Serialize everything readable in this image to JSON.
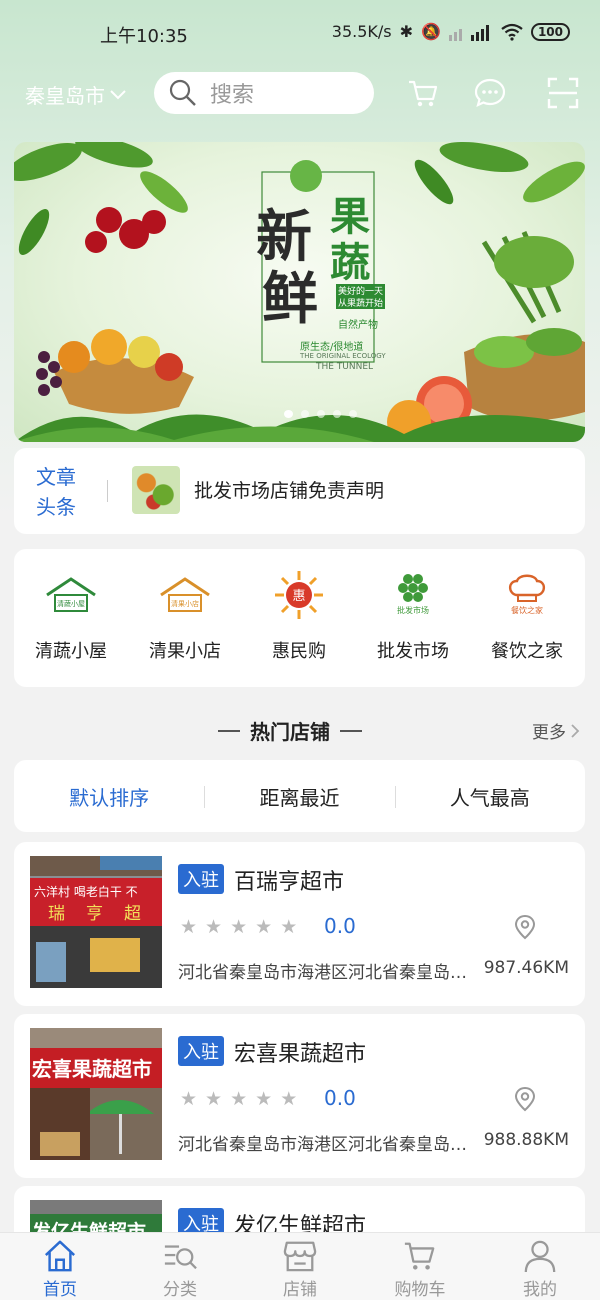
{
  "status_bar": {
    "time": "上午10:35",
    "network_speed": "35.5K/s",
    "battery": "100"
  },
  "header": {
    "city": "秦皇岛市",
    "search_placeholder": "搜索"
  },
  "banner": {
    "title_chars": [
      "新",
      "鲜",
      "果",
      "蔬"
    ],
    "slogan_lines": [
      "美好的一天",
      "从果蔬开始"
    ],
    "tagline": "自然产物",
    "sub": "原生态/很地道",
    "en1": "THE ORIGINAL ECOLOGY",
    "en2": "THE TUNNEL",
    "active_slide": 0,
    "slide_count": 5
  },
  "notice": {
    "tag_line1": "文章",
    "tag_line2": "头条",
    "text": "批发市场店铺免责声明"
  },
  "categories": [
    {
      "label": "清蔬小屋",
      "icon": "green-house-icon",
      "icon_text": "清蔬小屋",
      "color": "#2f8a3b"
    },
    {
      "label": "清果小店",
      "icon": "orange-house-icon",
      "icon_text": "清果小店",
      "color": "#d9902a"
    },
    {
      "label": "惠民购",
      "icon": "discount-burst-icon",
      "icon_text": "惠",
      "color": "#d83a2a"
    },
    {
      "label": "批发市场",
      "icon": "wholesale-grapes-icon",
      "icon_text": "批发市场",
      "color": "#3f9a3a"
    },
    {
      "label": "餐饮之家",
      "icon": "chef-hat-icon",
      "icon_text": "餐饮之家",
      "color": "#d9642a"
    }
  ],
  "hot_shops": {
    "title": "热门店铺",
    "more": "更多"
  },
  "sort_options": [
    {
      "label": "默认排序",
      "active": true
    },
    {
      "label": "距离最近",
      "active": false
    },
    {
      "label": "人气最高",
      "active": false
    }
  ],
  "shops": [
    {
      "badge": "入驻",
      "name": "百瑞亨超市",
      "rating": "0.0",
      "stars": 0,
      "address": "河北省秦皇岛市海港区河北省秦皇岛市海港区",
      "distance": "987.46KM",
      "sign": [
        "瑞",
        "亨",
        "超"
      ],
      "sign_top": "六洋村 喝老白干 不"
    },
    {
      "badge": "入驻",
      "name": "宏喜果蔬超市",
      "rating": "0.0",
      "stars": 0,
      "address": "河北省秦皇岛市海港区河北省秦皇岛市海港区",
      "distance": "988.88KM",
      "sign": [
        "宏喜果蔬超市"
      ],
      "sign_top": ""
    },
    {
      "badge": "入驻",
      "name": "发亿生鲜超市",
      "rating": "",
      "stars": 0,
      "address": "",
      "distance": "",
      "sign": [
        "发亿生鲜超市"
      ],
      "sign_top": ""
    }
  ],
  "tabs": [
    {
      "label": "首页",
      "icon": "home-icon",
      "active": true
    },
    {
      "label": "分类",
      "icon": "category-search-icon",
      "active": false
    },
    {
      "label": "店铺",
      "icon": "store-icon",
      "active": false
    },
    {
      "label": "购物车",
      "icon": "cart-icon",
      "active": false
    },
    {
      "label": "我的",
      "icon": "user-icon",
      "active": false
    }
  ],
  "colors": {
    "accent": "#2a6bd1",
    "star_empty": "#bbbbbb"
  }
}
